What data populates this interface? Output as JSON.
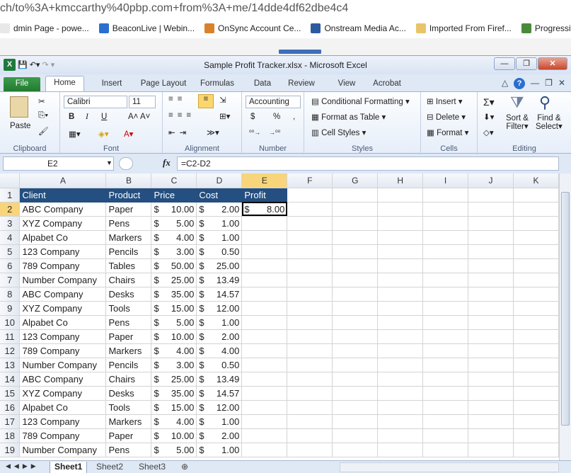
{
  "browser": {
    "url": "ch/to%3A+kmccarthy%40pbp.com+from%3A+me/14dde4df62dbe4c4",
    "bookmarks": [
      {
        "label": "dmin Page - powe...",
        "color": "#e8e8e8"
      },
      {
        "label": "BeaconLive | Webin...",
        "color": "#2a6fcf"
      },
      {
        "label": "OnSync Account Ce...",
        "color": "#d9822b"
      },
      {
        "label": "Onstream Media Ac...",
        "color": "#2c5aa0"
      },
      {
        "label": "Imported From Firef...",
        "color": "#e9c46a"
      },
      {
        "label": "Progressive V",
        "color": "#4a8a3a"
      }
    ]
  },
  "excel": {
    "title": "Sample Profit Tracker.xlsx  -  Microsoft Excel",
    "tabs": [
      "File",
      "Home",
      "Insert",
      "Page Layout",
      "Formulas",
      "Data",
      "Review",
      "View",
      "Acrobat"
    ],
    "ribbon": {
      "clipboard": {
        "label": "Clipboard",
        "paste": "Paste"
      },
      "font": {
        "label": "Font",
        "name": "Calibri",
        "size": "11",
        "bold": "B",
        "italic": "I",
        "underline": "U"
      },
      "alignment": {
        "label": "Alignment"
      },
      "number": {
        "label": "Number",
        "format": "Accounting",
        "currency": "$",
        "percent": "%",
        "comma": ","
      },
      "styles": {
        "label": "Styles",
        "conditional": "Conditional Formatting",
        "table": "Format as Table",
        "cell": "Cell Styles"
      },
      "cells": {
        "label": "Cells",
        "insert": "Insert",
        "delete": "Delete",
        "format": "Format"
      },
      "editing": {
        "label": "Editing",
        "sort": "Sort &",
        "sort2": "Filter",
        "find": "Find &",
        "find2": "Select"
      }
    },
    "namebox": "E2",
    "fx": "fx",
    "formula": "=C2-D2",
    "columns": [
      "A",
      "B",
      "C",
      "D",
      "E",
      "F",
      "G",
      "H",
      "I",
      "J",
      "K"
    ],
    "header": [
      "Client",
      "Product",
      "Price",
      "Cost",
      "Profit"
    ],
    "rows": [
      [
        "ABC Company",
        "Paper",
        "10.00",
        "2.00",
        "8.00"
      ],
      [
        "XYZ Company",
        "Pens",
        "5.00",
        "1.00",
        ""
      ],
      [
        "Alpabet Co",
        "Markers",
        "4.00",
        "1.00",
        ""
      ],
      [
        "123 Company",
        "Pencils",
        "3.00",
        "0.50",
        ""
      ],
      [
        "789 Company",
        "Tables",
        "50.00",
        "25.00",
        ""
      ],
      [
        "Number Company",
        "Chairs",
        "25.00",
        "13.49",
        ""
      ],
      [
        "ABC Company",
        "Desks",
        "35.00",
        "14.57",
        ""
      ],
      [
        "XYZ Company",
        "Tools",
        "15.00",
        "12.00",
        ""
      ],
      [
        "Alpabet Co",
        "Pens",
        "5.00",
        "1.00",
        ""
      ],
      [
        "123 Company",
        "Paper",
        "10.00",
        "2.00",
        ""
      ],
      [
        "789 Company",
        "Markers",
        "4.00",
        "4.00",
        ""
      ],
      [
        "Number Company",
        "Pencils",
        "3.00",
        "0.50",
        ""
      ],
      [
        "ABC Company",
        "Chairs",
        "25.00",
        "13.49",
        ""
      ],
      [
        "XYZ Company",
        "Desks",
        "35.00",
        "14.57",
        ""
      ],
      [
        "Alpabet Co",
        "Tools",
        "15.00",
        "12.00",
        ""
      ],
      [
        "123 Company",
        "Markers",
        "4.00",
        "1.00",
        ""
      ],
      [
        "789 Company",
        "Paper",
        "10.00",
        "2.00",
        ""
      ],
      [
        "Number Company",
        "Pens",
        "5.00",
        "1.00",
        ""
      ]
    ],
    "currency": "$",
    "sheets": [
      "Sheet1",
      "Sheet2",
      "Sheet3"
    ],
    "colors": {
      "header_fill": "#244f80",
      "selected_header": "#f8d57a",
      "file_tab": "#217b2f"
    }
  }
}
